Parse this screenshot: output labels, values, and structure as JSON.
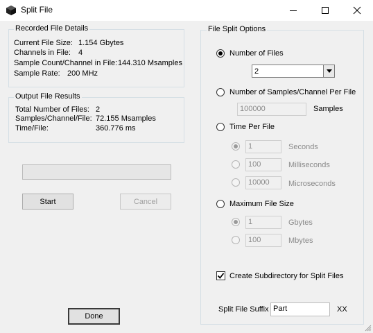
{
  "window": {
    "title": "Split File"
  },
  "recorded": {
    "legend": "Recorded File Details",
    "rows": [
      {
        "label": "Current File Size:",
        "value": "1.154 Gbytes"
      },
      {
        "label": "Channels in File:",
        "value": "4"
      },
      {
        "label": "Sample Count/Channel in File:",
        "value": "144.310 Msamples"
      },
      {
        "label": "Sample Rate:",
        "value": "200 MHz"
      }
    ]
  },
  "output": {
    "legend": "Output File Results",
    "rows": [
      {
        "label": "Total Number of Files:",
        "value": "2"
      },
      {
        "label": "Samples/Channel/File:",
        "value": "72.155 Msamples"
      },
      {
        "label": "Time/File:",
        "value": "360.776 ms"
      }
    ]
  },
  "progress": {
    "fraction": 0
  },
  "buttons": {
    "start": "Start",
    "cancel": "Cancel",
    "done": "Done"
  },
  "options": {
    "legend": "File Split Options",
    "num_files": {
      "label": "Number of Files",
      "selected": true,
      "value": "2"
    },
    "samples_per_file": {
      "label": "Number of Samples/Channel Per File",
      "selected": false,
      "value": "100000",
      "unit": "Samples"
    },
    "time_per_file": {
      "label": "Time Per File",
      "selected": false,
      "seconds": {
        "value": "1",
        "unit": "Seconds",
        "selected": true
      },
      "milliseconds": {
        "value": "100",
        "unit": "Milliseconds",
        "selected": false
      },
      "microseconds": {
        "value": "10000",
        "unit": "Microseconds",
        "selected": false
      }
    },
    "max_file_size": {
      "label": "Maximum File Size",
      "selected": false,
      "gbytes": {
        "value": "1",
        "unit": "Gbytes",
        "selected": true
      },
      "mbytes": {
        "value": "100",
        "unit": "Mbytes",
        "selected": false
      }
    },
    "subdirectory": {
      "label": "Create Subdirectory for Split Files",
      "checked": true
    },
    "suffix": {
      "label": "Split File Suffix",
      "value": "Part",
      "trailing": "XX"
    }
  }
}
